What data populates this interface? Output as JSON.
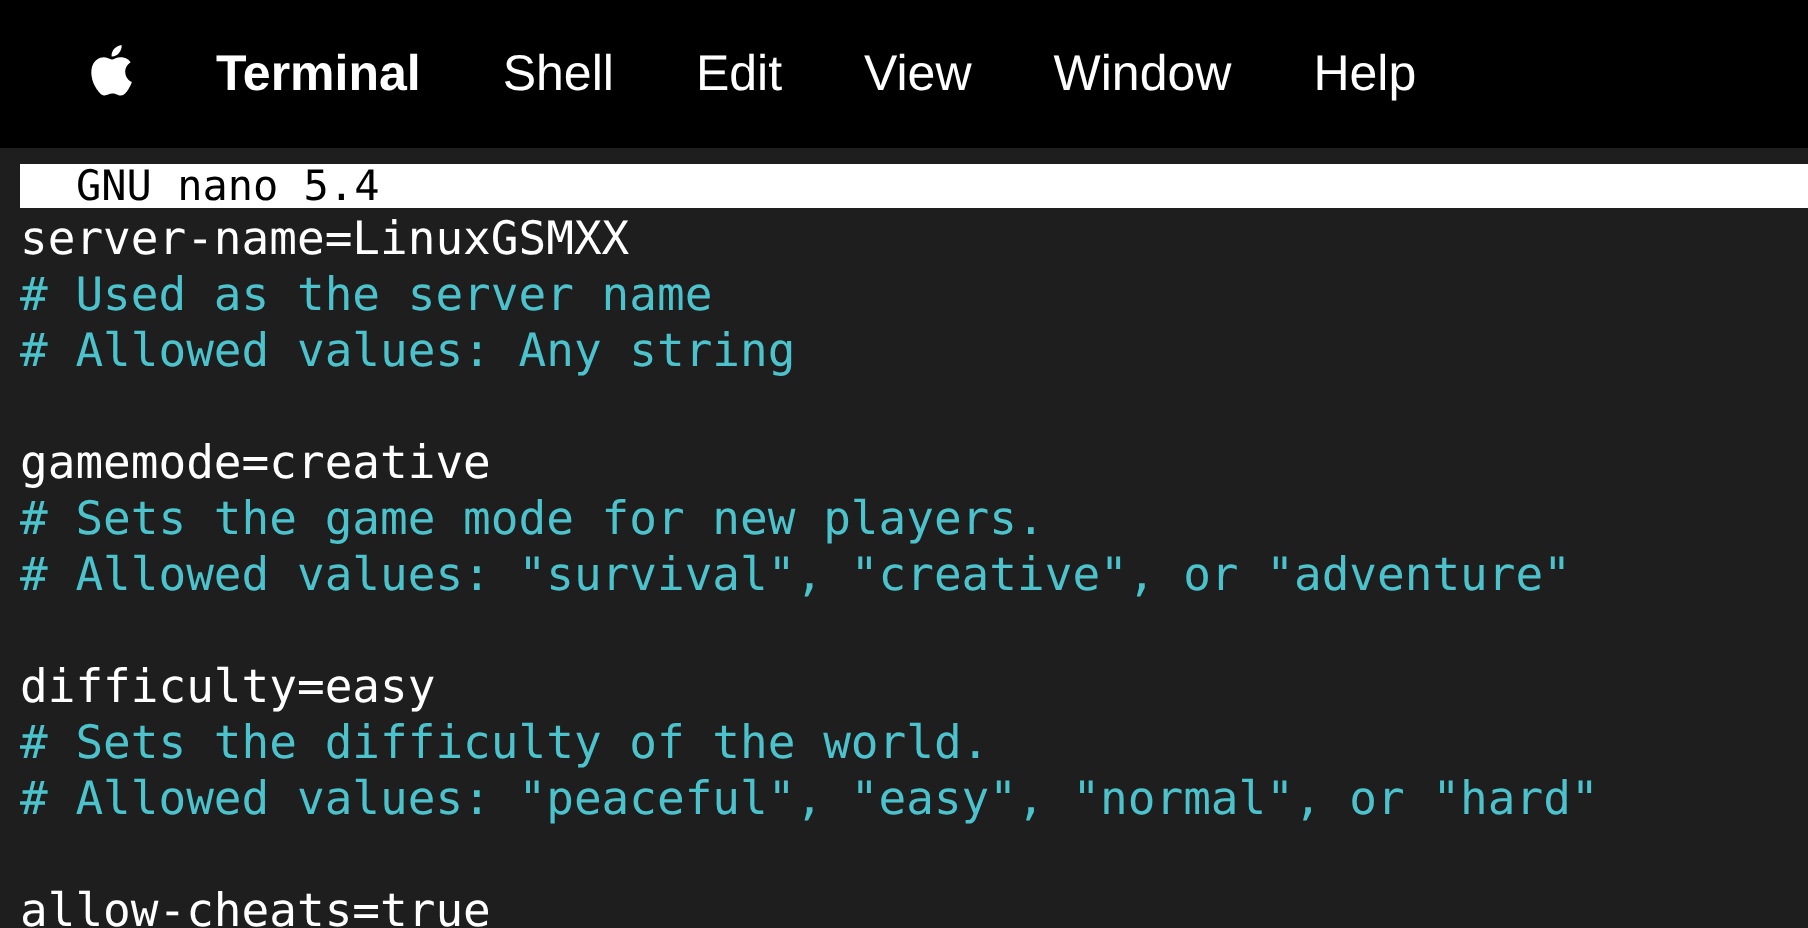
{
  "menu_bar": {
    "items": [
      {
        "label": "Terminal",
        "kind": "app"
      },
      {
        "label": "Shell",
        "kind": "menu"
      },
      {
        "label": "Edit",
        "kind": "menu"
      },
      {
        "label": "View",
        "kind": "menu"
      },
      {
        "label": "Window",
        "kind": "menu"
      },
      {
        "label": "Help",
        "kind": "menu"
      }
    ]
  },
  "editor": {
    "title": "GNU nano 5.4",
    "lines": [
      {
        "kind": "setting",
        "text": "server-name=LinuxGSMXX"
      },
      {
        "kind": "comment",
        "text": "# Used as the server name"
      },
      {
        "kind": "comment",
        "text": "# Allowed values: Any string"
      },
      {
        "kind": "blank"
      },
      {
        "kind": "setting",
        "text": "gamemode=creative"
      },
      {
        "kind": "comment",
        "text": "# Sets the game mode for new players."
      },
      {
        "kind": "comment",
        "text": "# Allowed values: \"survival\", \"creative\", or \"adventure\""
      },
      {
        "kind": "blank"
      },
      {
        "kind": "setting",
        "text": "difficulty=easy"
      },
      {
        "kind": "comment",
        "text": "# Sets the difficulty of the world."
      },
      {
        "kind": "comment",
        "text": "# Allowed values: \"peaceful\", \"easy\", \"normal\", or \"hard\""
      },
      {
        "kind": "blank"
      },
      {
        "kind": "setting",
        "text": "allow-cheats=true"
      }
    ]
  }
}
